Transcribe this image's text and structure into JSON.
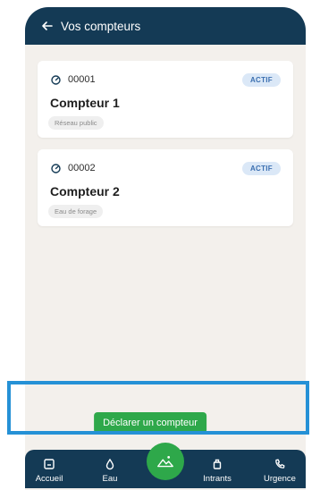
{
  "header": {
    "title": "Vos compteurs"
  },
  "meters": [
    {
      "code": "00001",
      "status": "ACTIF",
      "name": "Compteur 1",
      "source": "Réseau public"
    },
    {
      "code": "00002",
      "status": "ACTIF",
      "name": "Compteur 2",
      "source": "Eau de forage"
    }
  ],
  "cta": {
    "label": "Déclarer un compteur"
  },
  "nav": {
    "items": [
      "Accueil",
      "Eau",
      "Intrants",
      "Urgence"
    ]
  },
  "colors": {
    "header": "#143a55",
    "accent_green": "#2ea84a",
    "badge_bg": "#dbe8f7",
    "badge_text": "#3b6fb0",
    "highlight": "#2591d6"
  }
}
